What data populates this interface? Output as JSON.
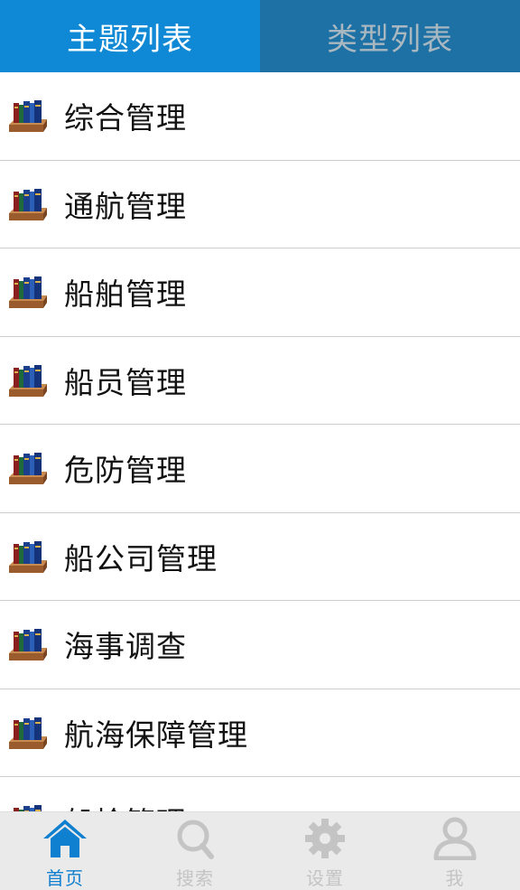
{
  "tabs": {
    "topic_list": "主题列表",
    "type_list": "类型列表",
    "active_color": "#0f89d5",
    "inactive_color": "#1d71a5"
  },
  "list": {
    "items": [
      {
        "label": "综合管理",
        "icon": "bookshelf-icon"
      },
      {
        "label": "通航管理",
        "icon": "bookshelf-icon"
      },
      {
        "label": "船舶管理",
        "icon": "bookshelf-icon"
      },
      {
        "label": "船员管理",
        "icon": "bookshelf-icon"
      },
      {
        "label": "危防管理",
        "icon": "bookshelf-icon"
      },
      {
        "label": "船公司管理",
        "icon": "bookshelf-icon"
      },
      {
        "label": "海事调查",
        "icon": "bookshelf-icon"
      },
      {
        "label": "航海保障管理",
        "icon": "bookshelf-icon"
      },
      {
        "label": "船检管理",
        "icon": "bookshelf-icon"
      }
    ]
  },
  "bottom_nav": {
    "home": {
      "label": "首页",
      "icon": "home-icon"
    },
    "search": {
      "label": "搜索",
      "icon": "search-icon"
    },
    "settings": {
      "label": "设置",
      "icon": "gear-icon"
    },
    "me": {
      "label": "我",
      "icon": "user-icon"
    },
    "active_color": "#0f7fcf"
  }
}
